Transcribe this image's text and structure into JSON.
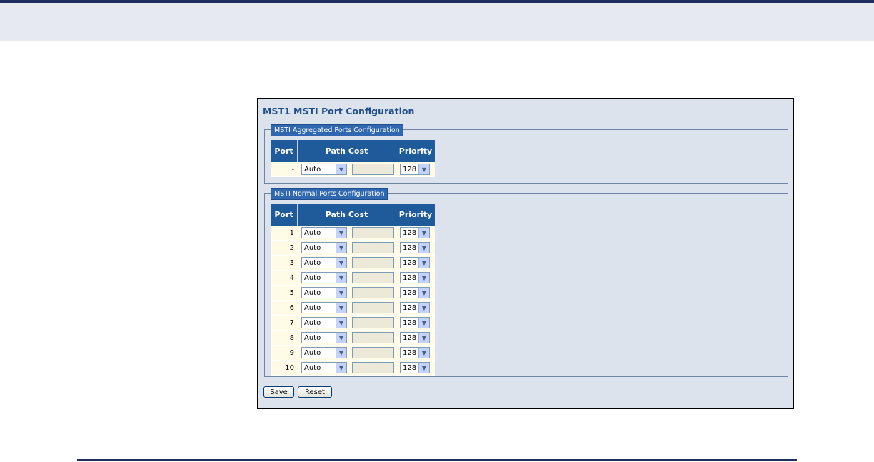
{
  "page": {
    "title": "MST1 MSTI Port Configuration"
  },
  "aggregated": {
    "legend": "MSTI Aggregated Ports Configuration",
    "headers": {
      "port": "Port",
      "path_cost": "Path Cost",
      "priority": "Priority"
    },
    "rows": [
      {
        "port": "-",
        "path_cost_mode": "Auto",
        "path_cost_value": "",
        "priority": "128"
      }
    ]
  },
  "normal": {
    "legend": "MSTI Normal Ports Configuration",
    "headers": {
      "port": "Port",
      "path_cost": "Path Cost",
      "priority": "Priority"
    },
    "rows": [
      {
        "port": "1",
        "path_cost_mode": "Auto",
        "path_cost_value": "",
        "priority": "128"
      },
      {
        "port": "2",
        "path_cost_mode": "Auto",
        "path_cost_value": "",
        "priority": "128"
      },
      {
        "port": "3",
        "path_cost_mode": "Auto",
        "path_cost_value": "",
        "priority": "128"
      },
      {
        "port": "4",
        "path_cost_mode": "Auto",
        "path_cost_value": "",
        "priority": "128"
      },
      {
        "port": "5",
        "path_cost_mode": "Auto",
        "path_cost_value": "",
        "priority": "128"
      },
      {
        "port": "6",
        "path_cost_mode": "Auto",
        "path_cost_value": "",
        "priority": "128"
      },
      {
        "port": "7",
        "path_cost_mode": "Auto",
        "path_cost_value": "",
        "priority": "128"
      },
      {
        "port": "8",
        "path_cost_mode": "Auto",
        "path_cost_value": "",
        "priority": "128"
      },
      {
        "port": "9",
        "path_cost_mode": "Auto",
        "path_cost_value": "",
        "priority": "128"
      },
      {
        "port": "10",
        "path_cost_mode": "Auto",
        "path_cost_value": "",
        "priority": "128"
      }
    ]
  },
  "buttons": {
    "save": "Save",
    "reset": "Reset"
  },
  "icons": {
    "dropdown": "chevron-down-icon"
  },
  "colors": {
    "header_bg": "#1f5b9b",
    "legend_bg": "#2f67b1",
    "panel_bg": "#dde3ec",
    "row_bg": "#fffbe6",
    "title": "#1f4f8a"
  }
}
